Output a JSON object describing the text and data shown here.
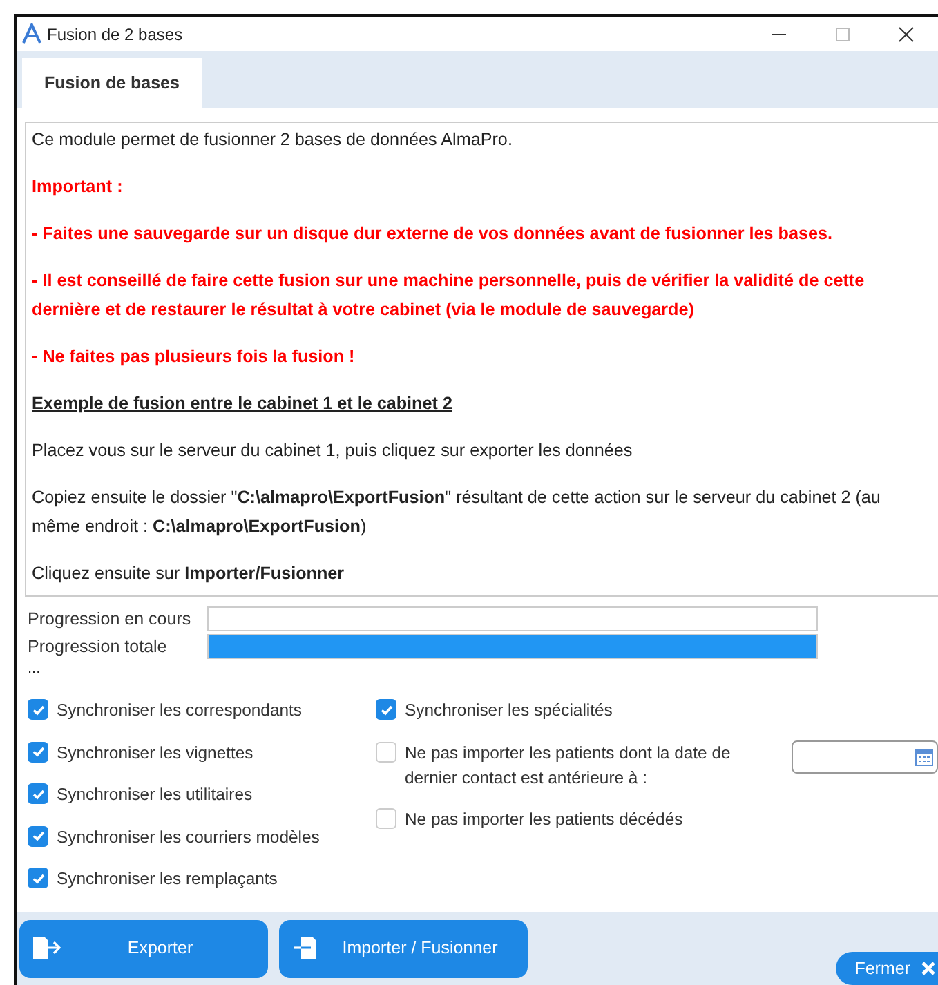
{
  "window": {
    "title": "Fusion de 2 bases"
  },
  "tabs": [
    {
      "label": "Fusion de bases",
      "selected": true
    }
  ],
  "info_paragraphs": [
    {
      "kind": "normal",
      "text": "Ce module permet de fusionner 2 bases de données AlmaPro."
    },
    {
      "kind": "warning",
      "text": "Important :"
    },
    {
      "kind": "warning",
      "text": "- Faites une sauvegarde sur un disque dur externe de vos données avant de fusionner les bases."
    },
    {
      "kind": "warning",
      "text": "- Il est conseillé de faire cette fusion sur une machine personnelle, puis de vérifier la validité de cette dernière et de restaurer le résultat à votre cabinet (via le module de sauvegarde)"
    },
    {
      "kind": "warning",
      "text": "- Ne faites pas plusieurs fois la fusion !"
    },
    {
      "kind": "heading",
      "text": "Exemple de fusion entre le cabinet 1 et le cabinet 2"
    },
    {
      "kind": "normal",
      "text": "Placez vous sur le serveur du cabinet 1, puis cliquez sur exporter les données"
    },
    {
      "kind": "normal",
      "text": "Copiez ensuite le dossier \"**C:\\almapro\\ExportFusion**\" résultant de cette action sur le serveur du cabinet 2 (au même endroit : **C:\\almapro\\ExportFusion**)"
    },
    {
      "kind": "normal",
      "text": "Cliquez ensuite sur **Importer/Fusionner**"
    }
  ],
  "progress": [
    {
      "label": "Progression en cours",
      "level": 0
    },
    {
      "label": "Progression totale",
      "level": 1
    }
  ],
  "status": "...",
  "options_left": [
    {
      "label": "Synchroniser les correspondants",
      "checked": true
    },
    {
      "label": "Synchroniser les vignettes",
      "checked": true
    },
    {
      "label": "Synchroniser les utilitaires",
      "checked": true
    },
    {
      "label": "Synchroniser les courriers modèles",
      "checked": true
    },
    {
      "label": "Synchroniser les remplaçants",
      "checked": true
    }
  ],
  "options_right": [
    {
      "kind": "plain",
      "label": "Synchroniser les spécialités",
      "checked": true
    },
    {
      "kind": "date",
      "label": "Ne pas importer les patients dont la date de dernier contact est antérieure à :",
      "checked": false
    },
    {
      "kind": "plain",
      "label": "Ne pas importer les patients décédés",
      "checked": false
    }
  ],
  "buttons": [
    {
      "kind": "export",
      "label": "Exporter"
    },
    {
      "kind": "import",
      "label": "Importer / Fusionner"
    }
  ],
  "close_button": {
    "label": "Fermer"
  }
}
